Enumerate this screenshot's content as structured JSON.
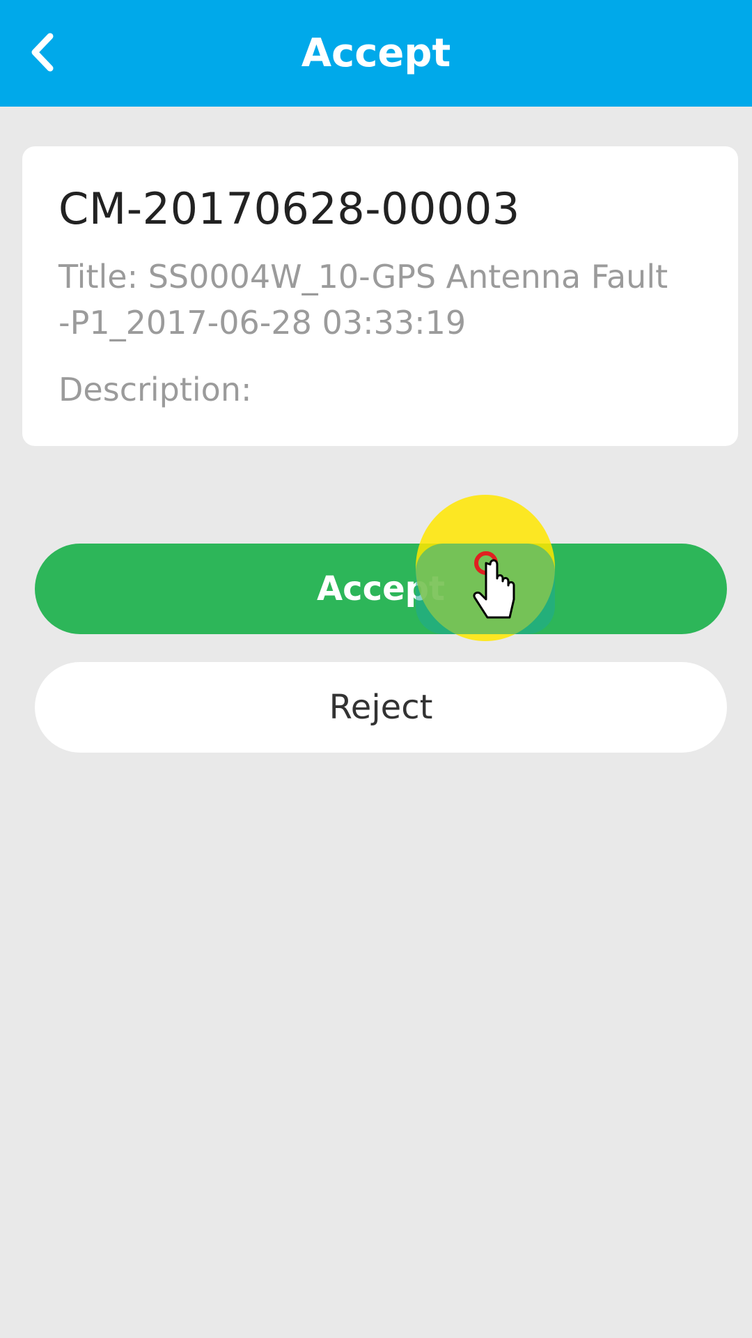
{
  "header": {
    "title": "Accept",
    "back_icon": "chevron-left-icon",
    "background_color": "#00a9ea"
  },
  "ticket": {
    "id": "CM-20170628-00003",
    "title_line1": "Title: SS0004W_10-GPS Antenna Fault",
    "title_line2": "-P1_2017-06-28 03:33:19",
    "description_label": "Description:"
  },
  "actions": {
    "accept_label": "Accept",
    "reject_label": "Reject",
    "accept_color": "#2db659"
  },
  "cursor": {
    "icon": "hand-pointer-icon"
  }
}
